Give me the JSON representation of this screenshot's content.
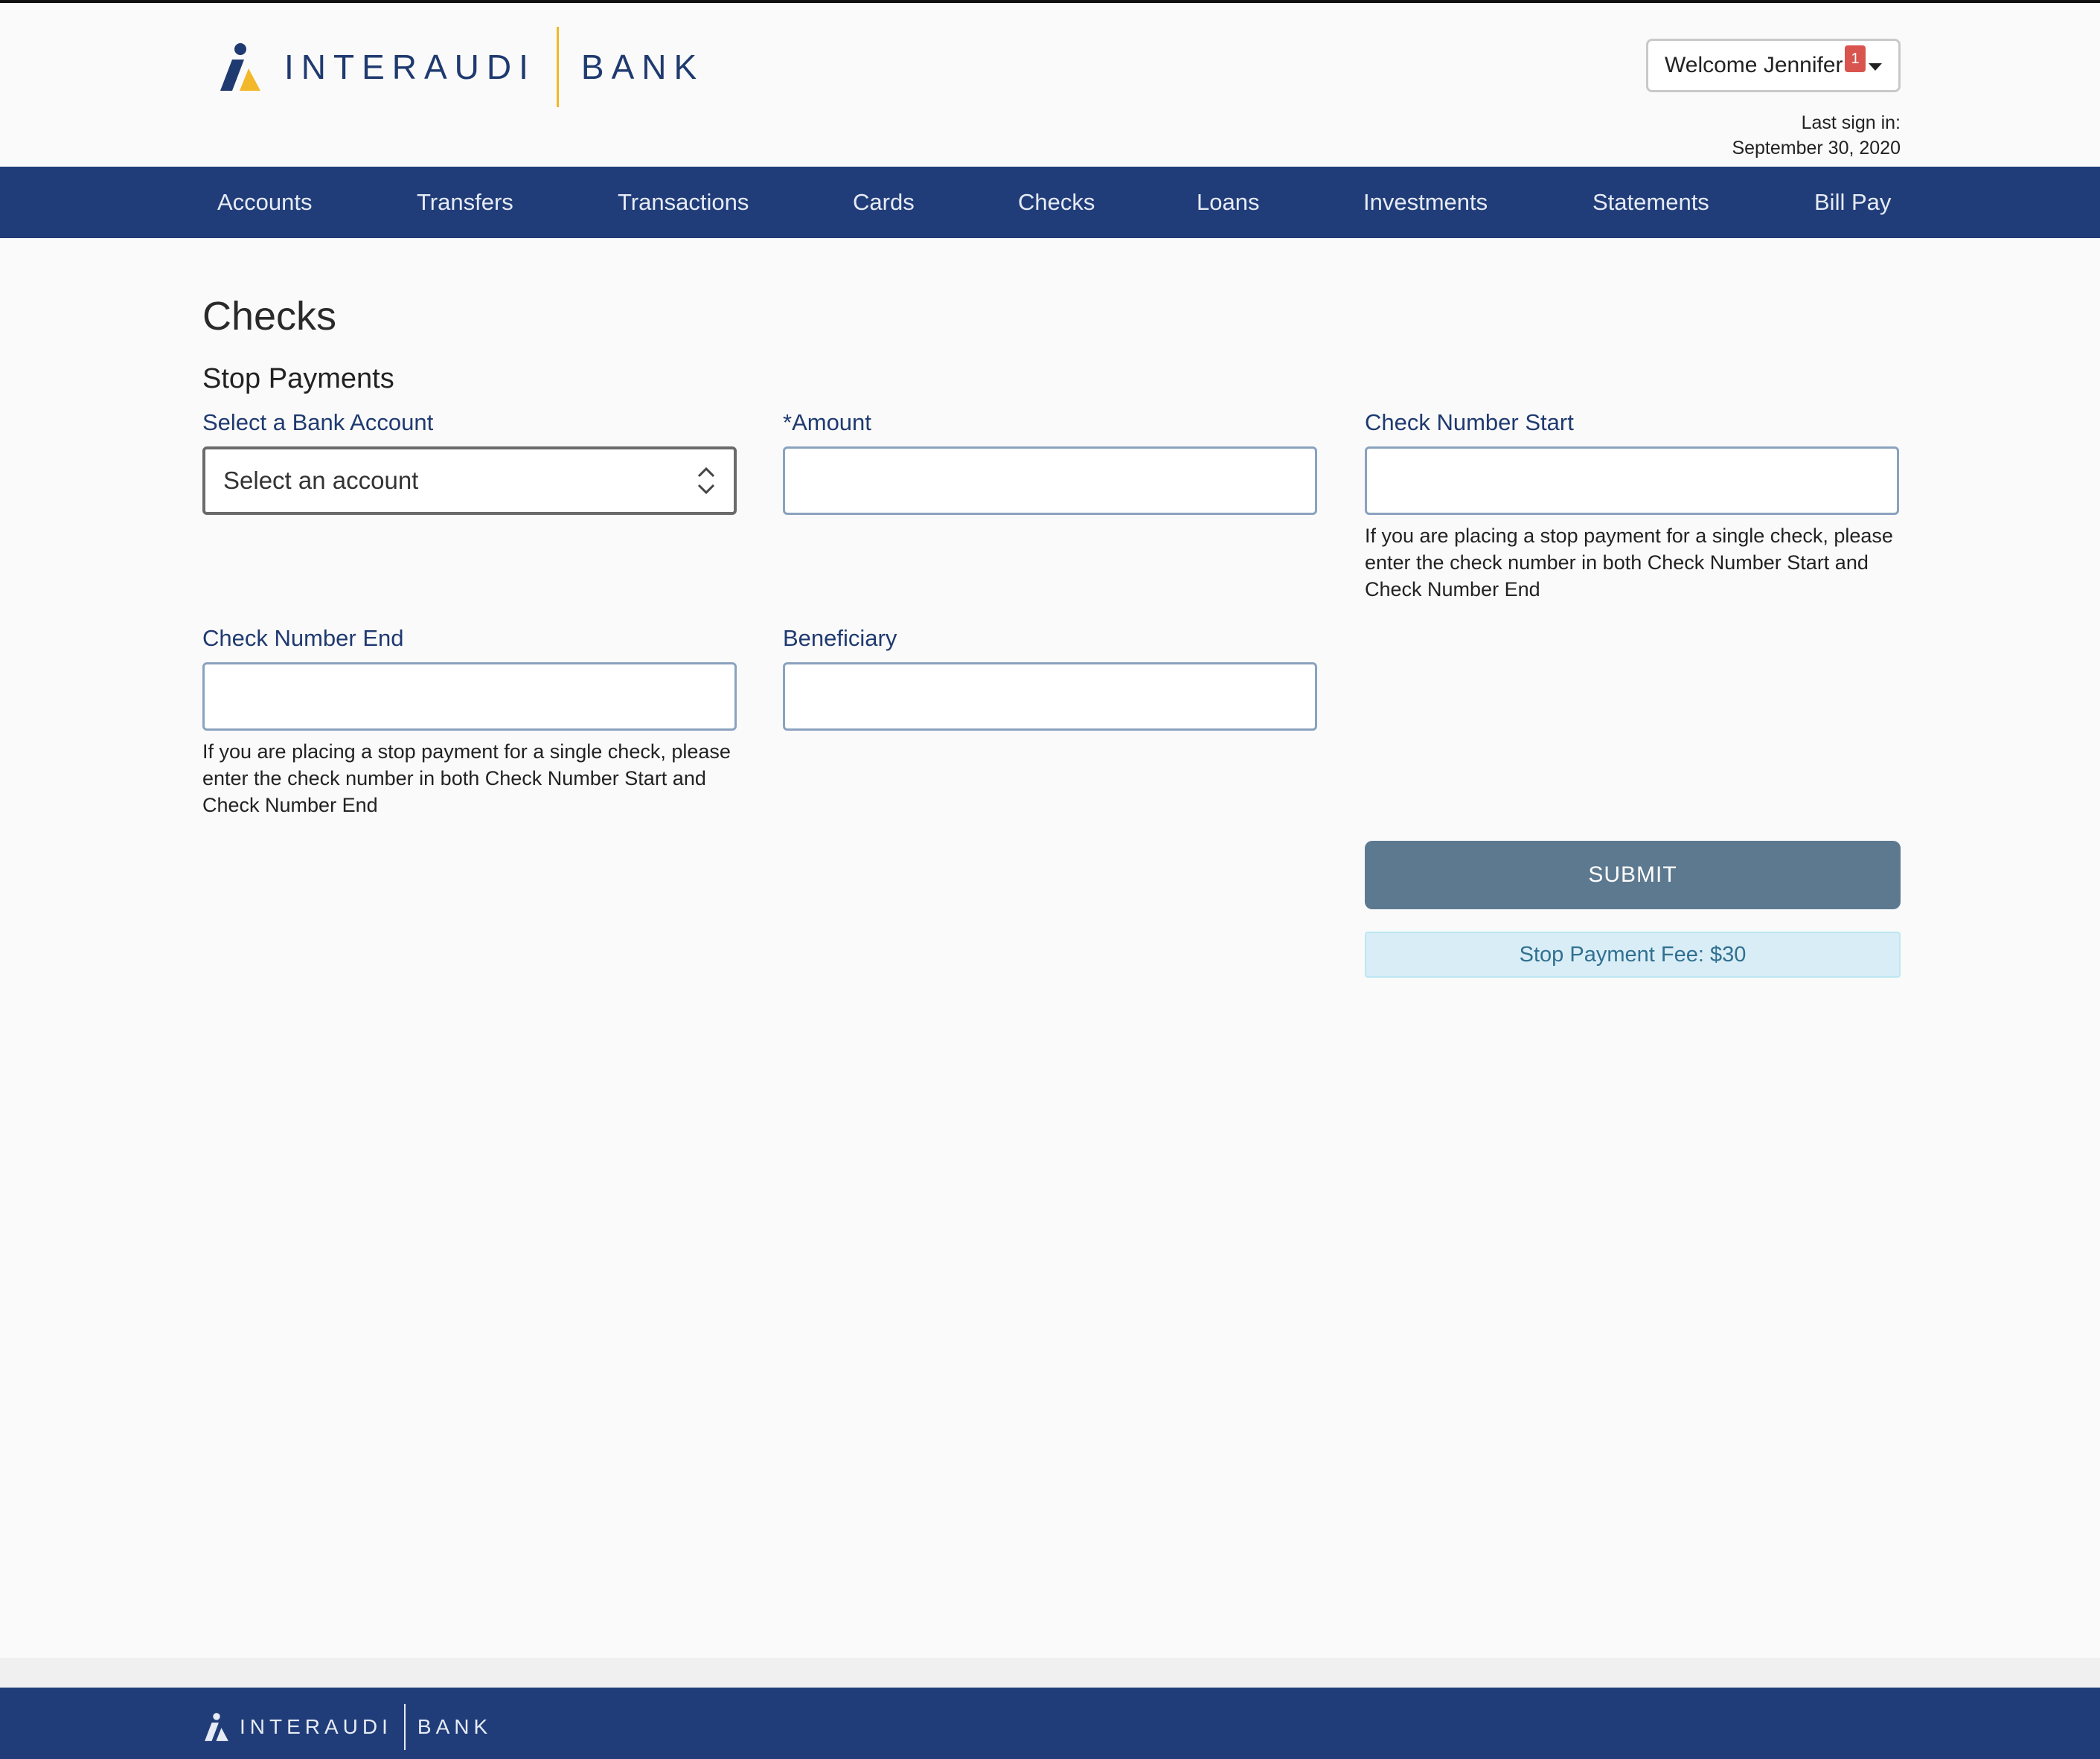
{
  "brand": {
    "name_part1": "INTERAUDI",
    "name_part2": "BANK",
    "primary_color": "#213d79",
    "accent_color": "#f2b82a"
  },
  "header": {
    "welcome_label": "Welcome Jennifer",
    "notification_count": "1",
    "last_sign_in_label": "Last sign in:",
    "last_sign_in_date": "September 30, 2020"
  },
  "nav": {
    "items": [
      "Accounts",
      "Transfers",
      "Transactions",
      "Cards",
      "Checks",
      "Loans",
      "Investments",
      "Statements",
      "Bill Pay"
    ]
  },
  "page": {
    "title": "Checks",
    "section": "Stop Payments"
  },
  "form": {
    "account_label": "Select a Bank Account",
    "account_placeholder": "Select an account",
    "amount_label": "*Amount",
    "amount_value": "",
    "check_start_label": "Check Number Start",
    "check_start_value": "",
    "check_start_help": "If you are placing a stop payment for a single check, please enter the check number in both Check Number Start and Check Number End",
    "check_end_label": "Check Number End",
    "check_end_value": "",
    "check_end_help": "If you are placing a stop payment for a single check, please enter the check number in both Check Number Start and Check Number End",
    "beneficiary_label": "Beneficiary",
    "beneficiary_value": "",
    "submit_label": "SUBMIT",
    "fee_notice": "Stop Payment Fee: $30"
  },
  "footer": {
    "name_part1": "INTERAUDI",
    "name_part2": "BANK"
  },
  "icons": {
    "logo": "bank-logo-icon",
    "dropdown": "caret-down-icon",
    "select": "select-arrows-icon"
  }
}
